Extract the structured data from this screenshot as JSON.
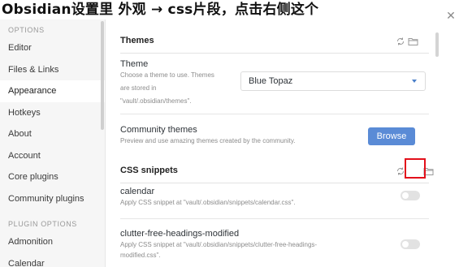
{
  "caption": "Obsidian设置里 外观 → css片段，点击右侧这个",
  "sidebar": {
    "heading_options": "OPTIONS",
    "items": [
      {
        "label": "Editor"
      },
      {
        "label": "Files & Links"
      },
      {
        "label": "Appearance"
      },
      {
        "label": "Hotkeys"
      },
      {
        "label": "About"
      },
      {
        "label": "Account"
      },
      {
        "label": "Core plugins"
      },
      {
        "label": "Community plugins"
      }
    ],
    "heading_plugin_options": "PLUGIN OPTIONS",
    "plugin_items": [
      {
        "label": "Admonition"
      },
      {
        "label": "Calendar"
      }
    ],
    "active_item": "Appearance"
  },
  "close_icon": "close-icon",
  "main": {
    "themes_section": {
      "title": "Themes",
      "theme": {
        "title": "Theme",
        "desc_line1": "Choose a theme to use. Themes",
        "desc_line2": "are stored in",
        "desc_line3": "\"vault/.obsidian/themes\".",
        "selected": "Blue Topaz"
      },
      "community": {
        "title": "Community themes",
        "desc": "Preview and use amazing themes created by the community.",
        "button": "Browse"
      }
    },
    "snippets_section": {
      "title": "CSS snippets",
      "items": [
        {
          "title": "calendar",
          "desc_line1": "Apply CSS snippet at \"vault/.obsidian/snippets/calendar.css\".",
          "desc_line2": ""
        },
        {
          "title": "clutter-free-headings-modified",
          "desc_line1": "Apply CSS snippet at \"vault/.obsidian/snippets/clutter-free-headings-",
          "desc_line2": "modified.css\"."
        }
      ]
    }
  },
  "colors": {
    "accent": "#5a8bd6",
    "highlight": "#e3101b"
  }
}
